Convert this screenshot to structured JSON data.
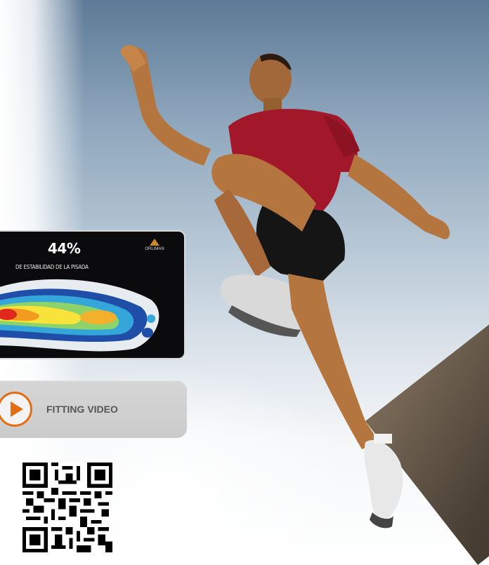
{
  "pressure_card": {
    "stability_value": "44%",
    "stability_caption": "DE ESTABILIDAD DE LA PISADA",
    "brand": "ORLIMAN"
  },
  "video_button": {
    "label": "FITTING VIDEO"
  },
  "colors": {
    "accent": "#e36f12",
    "button_bg": "#cfcfcf",
    "card_bg": "#0b0b0d",
    "shirt": "#a3172a"
  },
  "icons": [
    "play-icon",
    "qr-code-icon",
    "brand-logo-icon"
  ]
}
